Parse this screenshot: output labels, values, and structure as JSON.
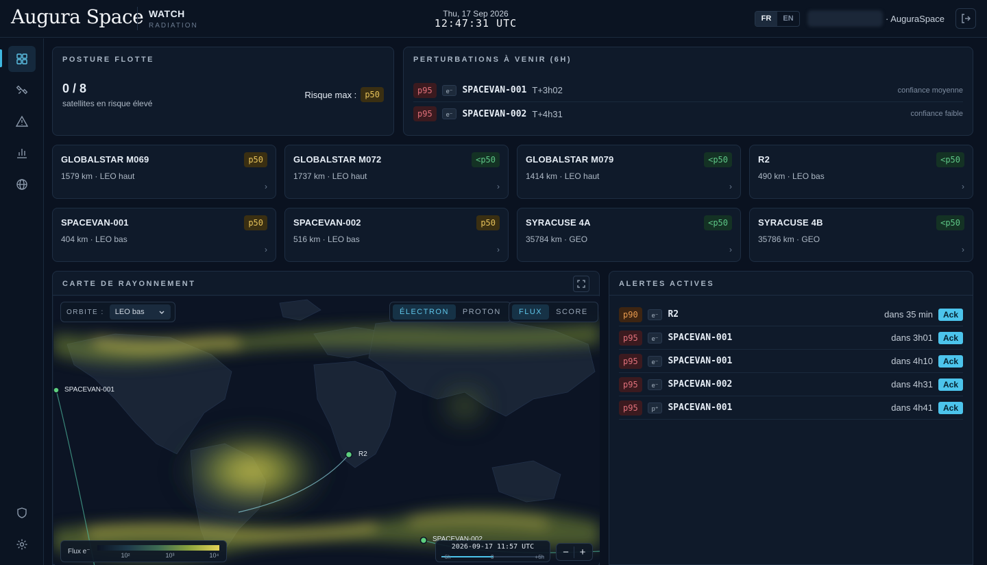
{
  "header": {
    "brand": "Augura Space",
    "module": "WATCH",
    "module_sub": "RADIATION",
    "date": "Thu, 17 Sep 2026",
    "time": "12:47:31 UTC",
    "lang_active": "FR",
    "lang_other": "EN",
    "org": "· AuguraSpace"
  },
  "posture": {
    "title": "POSTURE FLOTTE",
    "count": "0 / 8",
    "caption": "satellites en risque élevé",
    "risk_label": "Risque max :",
    "risk_value": "p50"
  },
  "perturbations": {
    "title": "PERTURBATIONS À VENIR (6H)",
    "items": [
      {
        "badge": "p95",
        "particle": "e⁻",
        "name": "SPACEVAN-001",
        "eta": "T+3h02",
        "confidence": "confiance moyenne"
      },
      {
        "badge": "p95",
        "particle": "e⁻",
        "name": "SPACEVAN-002",
        "eta": "T+4h31",
        "confidence": "confiance faible"
      }
    ]
  },
  "satellites": [
    {
      "name": "GLOBALSTAR M069",
      "info": "1579 km · LEO haut",
      "badge": "p50",
      "level": "p50"
    },
    {
      "name": "GLOBALSTAR M072",
      "info": "1737 km · LEO haut",
      "badge": "<p50",
      "level": "lt50"
    },
    {
      "name": "GLOBALSTAR M079",
      "info": "1414 km · LEO haut",
      "badge": "<p50",
      "level": "lt50"
    },
    {
      "name": "R2",
      "info": "490 km · LEO bas",
      "badge": "<p50",
      "level": "lt50"
    },
    {
      "name": "SPACEVAN-001",
      "info": "404 km · LEO bas",
      "badge": "p50",
      "level": "p50"
    },
    {
      "name": "SPACEVAN-002",
      "info": "516 km · LEO bas",
      "badge": "p50",
      "level": "p50"
    },
    {
      "name": "SYRACUSE 4A",
      "info": "35784 km · GEO",
      "badge": "<p50",
      "level": "lt50"
    },
    {
      "name": "SYRACUSE 4B",
      "info": "35786 km · GEO",
      "badge": "<p50",
      "level": "lt50"
    }
  ],
  "map": {
    "title": "CARTE DE RAYONNEMENT",
    "orbit_label": "ORBITE :",
    "orbit_value": "LEO bas",
    "particle_tabs": [
      "ÉLECTRON",
      "PROTON"
    ],
    "view_tabs": [
      "FLUX",
      "SCORE"
    ],
    "sat_labels": [
      "SPACEVAN-001",
      "R2",
      "SPACEVAN-002"
    ],
    "legend_label": "Flux e⁻",
    "legend_ticks": [
      "10²",
      "10³",
      "10⁴"
    ],
    "timeline_time": "2026-09-17 11:57 UTC",
    "timeline_ticks": [
      "−6h",
      "0",
      "+6h"
    ],
    "zoom_out": "−",
    "zoom_in": "+"
  },
  "alerts": {
    "title": "ALERTES ACTIVES",
    "ack_label": "Ack",
    "items": [
      {
        "badge": "p90",
        "particle": "e⁻",
        "name": "R2",
        "when": "dans 35 min"
      },
      {
        "badge": "p95",
        "particle": "e⁻",
        "name": "SPACEVAN-001",
        "when": "dans 3h01"
      },
      {
        "badge": "p95",
        "particle": "e⁻",
        "name": "SPACEVAN-001",
        "when": "dans 4h10"
      },
      {
        "badge": "p95",
        "particle": "e⁻",
        "name": "SPACEVAN-002",
        "when": "dans 4h31"
      },
      {
        "badge": "p95",
        "particle": "p⁺",
        "name": "SPACEVAN-001",
        "when": "dans 4h41"
      }
    ]
  },
  "colors": {
    "accent": "#4cc4ec",
    "p50": "#e6c25a",
    "lt50": "#5ec787",
    "p95": "#e0707a",
    "p90": "#e79a4e"
  }
}
